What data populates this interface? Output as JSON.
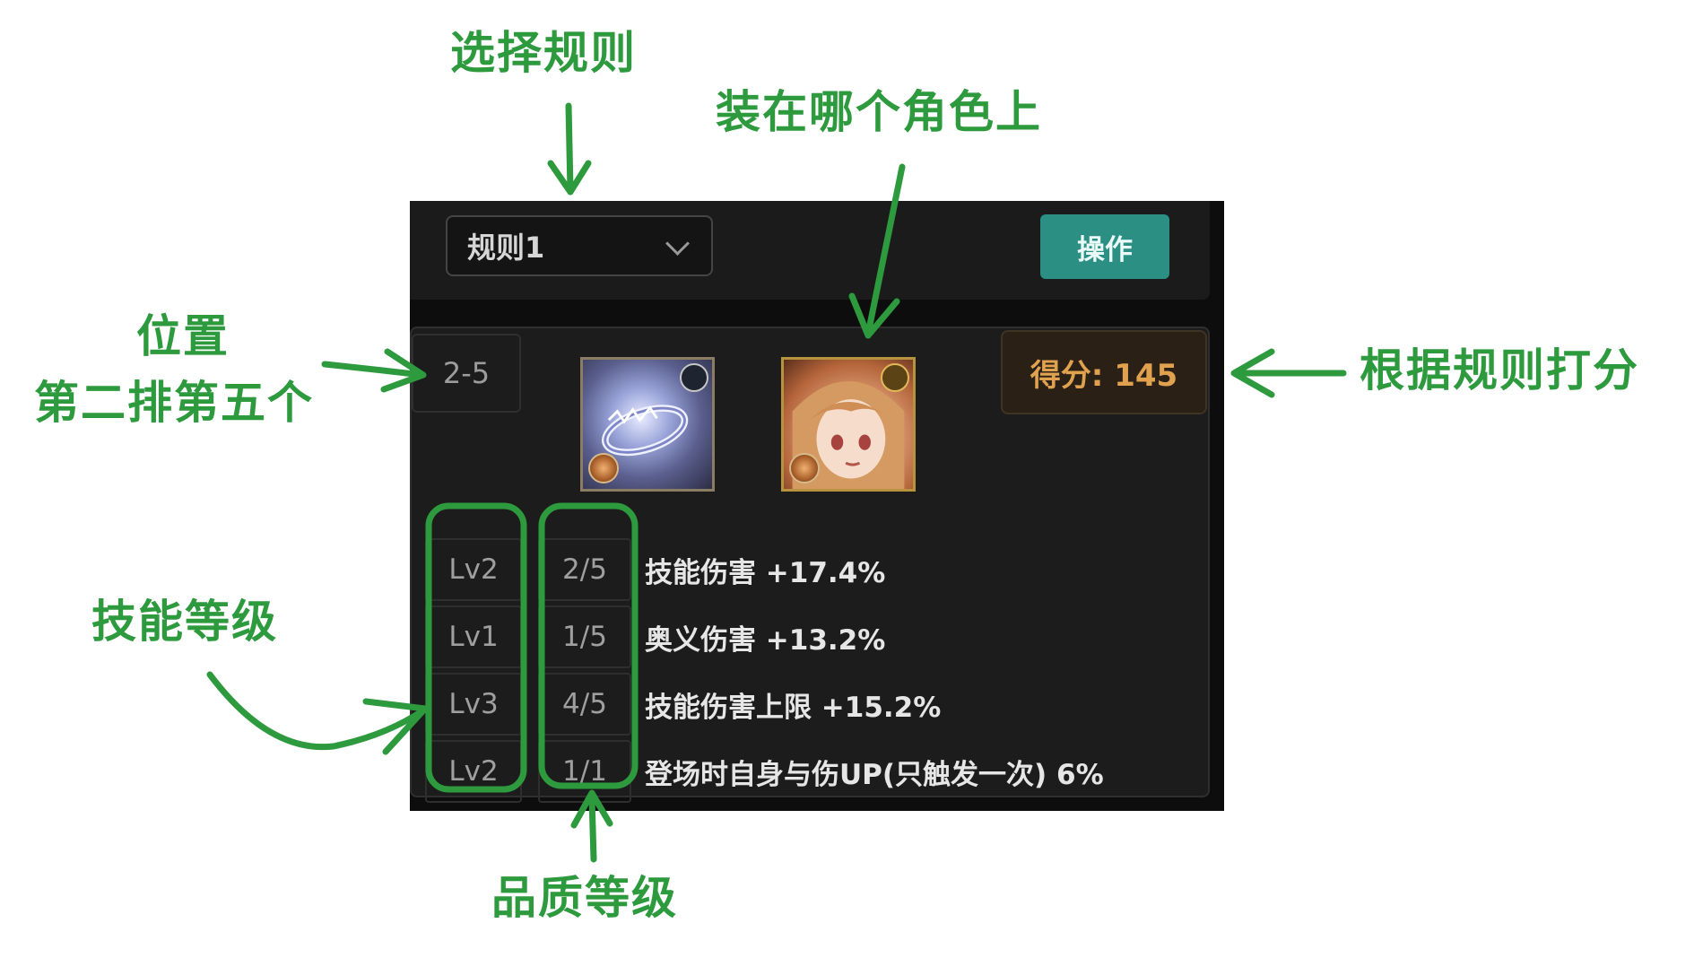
{
  "panel": {
    "rule_select": {
      "value": "规则1"
    },
    "operate_button": "操作",
    "card": {
      "position": "2-5",
      "score": "得分: 145",
      "stats": [
        {
          "skill_level": "Lv2",
          "quality": "2/5",
          "text": "技能伤害 +17.4%"
        },
        {
          "skill_level": "Lv1",
          "quality": "1/5",
          "text": "奥义伤害 +13.2%"
        },
        {
          "skill_level": "Lv3",
          "quality": "4/5",
          "text": "技能伤害上限 +15.2%"
        },
        {
          "skill_level": "Lv2",
          "quality": "1/1",
          "text": "登场时自身与伤UP(只触发一次) 6%"
        }
      ]
    }
  },
  "annotations": {
    "select_rule": "选择规则",
    "equipped_on": "装在哪个角色上",
    "position_title": "位置",
    "position_detail": "第二排第五个",
    "score_by_rule": "根据规则打分",
    "skill_level": "技能等级",
    "quality_level": "品质等级",
    "color": "#2e9a3e"
  }
}
